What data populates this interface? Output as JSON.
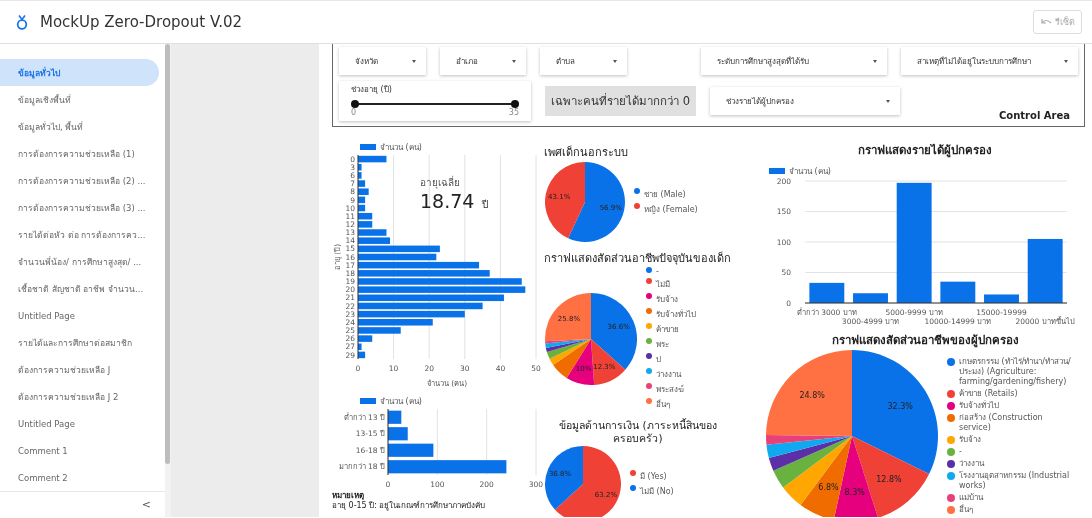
{
  "app_bar": {
    "title": "MockUp Zero-Dropout V.02",
    "reset_button": "รีเซ็ต"
  },
  "sidebar": {
    "items": [
      {
        "label": "ข้อมูลทั่วไป",
        "selected": true
      },
      {
        "label": "ข้อมูลเชิงพื้นที่",
        "selected": false
      },
      {
        "label": "ข้อมูลทั่วไป, พื้นที่",
        "selected": false
      },
      {
        "label": "การต้องการความช่วยเหลือ (1)",
        "selected": false
      },
      {
        "label": "การต้องการความช่วยเหลือ (2) ...",
        "selected": false
      },
      {
        "label": "การต้องการความช่วยเหลือ (3) ...",
        "selected": false
      },
      {
        "label": "รายได้ต่อหัว ต่อ การต้องการคว...",
        "selected": false
      },
      {
        "label": "จำนวนพี่น้อง/ การศึกษาสูงสุด/ ...",
        "selected": false
      },
      {
        "label": "เชื้อชาติ สัญชาติ อาชีพ จำนวน...",
        "selected": false
      },
      {
        "label": "Untitled Page",
        "selected": false
      },
      {
        "label": "รายได้และการศึกษาต่อสมาชิก",
        "selected": false
      },
      {
        "label": "ต้องการความช่วยเหลือ J",
        "selected": false
      },
      {
        "label": "ต้องการความช่วยเหลือ J 2",
        "selected": false
      },
      {
        "label": "Untitled Page",
        "selected": false
      },
      {
        "label": "Comment 1",
        "selected": false
      },
      {
        "label": "Comment 2",
        "selected": false
      }
    ],
    "collapse_button": "<"
  },
  "control_area": {
    "dropdowns": [
      "จังหวัด",
      "อำเภอ",
      "ตำบล",
      "ระดับการศึกษาสูงสุดที่ได้รับ",
      "สาเหตุที่ไม่ได้อยู่ในระบบการศึกษา"
    ],
    "age_slider": {
      "label": "ช่วงอายุ (ปี)",
      "min_label": "0",
      "max_label": "35",
      "level": 1
    },
    "income_filter_button": "เฉพาะคนที่รายได้มากกว่า 0",
    "income_dropdown": "ช่วงรายได้ผู้ปกครอง",
    "caption": "Control Area"
  },
  "age_chart": {
    "average_label": "อายุเฉลี่ย",
    "average_value": "18.74",
    "average_unit": "ปี",
    "chart_data": {
      "type": "bar",
      "orientation": "horizontal",
      "xlabel": "จำนวน (คน)",
      "ylabel": "อายุ (ปี)",
      "categories": [
        "0",
        "3",
        "6",
        "7",
        "8",
        "9",
        "10",
        "11",
        "12",
        "13",
        "14",
        "15",
        "16",
        "17",
        "18",
        "19",
        "20",
        "21",
        "22",
        "23",
        "24",
        "25",
        "26",
        "27",
        "29"
      ],
      "series": [
        {
          "name": "จำนวน (คน)",
          "color": "#0a72e8",
          "values": [
            8,
            1,
            1,
            2,
            3,
            2,
            2,
            4,
            4,
            8,
            9,
            23,
            22,
            34,
            37,
            46,
            47,
            41,
            35,
            30,
            21,
            12,
            4,
            1,
            2
          ]
        }
      ],
      "xlim": [
        0,
        50
      ],
      "xticks": [
        0,
        10,
        20,
        30,
        40,
        50
      ],
      "grid": true
    }
  },
  "age_group_chart": {
    "chart_data": {
      "type": "bar",
      "orientation": "horizontal",
      "categories": [
        "ต่ำกว่า 13 ปี",
        "13-15 ปี",
        "16-18 ปี",
        "มากกว่า 18 ปี"
      ],
      "series": [
        {
          "name": "จำนวน (คน)",
          "color": "#0a72e8",
          "values": [
            27,
            40,
            92,
            240
          ]
        }
      ],
      "xlim": [
        0,
        300
      ],
      "xticks": [
        0,
        100,
        200,
        300
      ],
      "grid": true
    }
  },
  "note": {
    "title": "หมายเหตุ",
    "text": "อายุ 0-15 ปี: อยู่ในเกณฑ์การศึกษาภาคบังคับ"
  },
  "gender_chart": {
    "chart_data": {
      "type": "pie",
      "title": "เพศเด็กนอกระบบ",
      "categories": [
        "ชาย (Male)",
        "หญิง (Female)"
      ],
      "values": [
        56.9,
        43.1
      ],
      "colors": [
        "#0a72e8",
        "#ef4136"
      ],
      "value_labels": [
        "56.9%",
        "43.1%"
      ]
    }
  },
  "child_job_chart": {
    "chart_data": {
      "type": "pie",
      "title": "กราฟแสดงสัดส่วนอาชีพปัจจุบันของเด็ก",
      "categories": [
        "-",
        "ไม่มี",
        "รับจ้าง",
        "รับจ้างทั่วไป",
        "ค้าขาย",
        "พระ",
        "ป",
        "ว่างงาน",
        "พระสงฆ์",
        "อื่นๆ"
      ],
      "values": [
        36.6,
        12.3,
        10,
        6.5,
        2.5,
        2.5,
        1.5,
        1.5,
        0.8,
        25.8
      ],
      "colors": [
        "#0a72e8",
        "#ef4136",
        "#e6007e",
        "#f06b00",
        "#ffa600",
        "#6ab23f",
        "#5b2fa8",
        "#0fa9f0",
        "#e8417a",
        "#ff7043"
      ],
      "value_labels": [
        "36.6%",
        "12.3%",
        "10%",
        null,
        null,
        null,
        null,
        null,
        null,
        "25.8%"
      ]
    }
  },
  "debt_chart": {
    "chart_data": {
      "type": "pie",
      "title": "ข้อมูลด้านการเงิน (ภาระหนี้สินของครอบครัว)",
      "categories": [
        "มี (Yes)",
        "ไม่มี (No)"
      ],
      "values": [
        63.2,
        36.8
      ],
      "colors": [
        "#ef4136",
        "#0a72e8"
      ],
      "value_labels": [
        "63.2%",
        "36.8%"
      ]
    }
  },
  "income_chart": {
    "chart_data": {
      "type": "bar",
      "title": "กราฟแสดงรายได้ผู้ปกครอง",
      "categories": [
        "ต่ำกว่า 3000 บาท",
        "3000-4999 บาท",
        "5000-9999 บาท",
        "10000-14999 บาท",
        "15000-19999",
        "20000 บาทขึ้นไป"
      ],
      "series": [
        {
          "name": "จำนวน (คน)",
          "color": "#0a72e8",
          "values": [
            33,
            16,
            197,
            35,
            14,
            105
          ]
        }
      ],
      "ylim": [
        0,
        200
      ],
      "yticks": [
        0,
        50,
        100,
        150,
        200
      ],
      "grid": true
    }
  },
  "parent_job_chart": {
    "chart_data": {
      "type": "pie",
      "title": "กราฟแสดงสัดส่วนอาชีพของผู้ปกครอง",
      "categories": [
        "เกษตรกรรม (ทำไร่/ทำนา/ทำสวน/ประมง) (Agriculture: farming/gardening/fishery)",
        "ค้าขาย (Retails)",
        "รับจ้างทั่วไป",
        "ก่อสร้าง (Construction service)",
        "รับจ้าง",
        "-",
        "ว่างงาน",
        "โรงงานอุตสาหกรรม (Industrial works)",
        "แม่บ้าน",
        "อื่นๆ"
      ],
      "values": [
        32.3,
        12.8,
        8.3,
        6.8,
        4.6,
        3.6,
        2.5,
        2.5,
        1.8,
        24.8
      ],
      "colors": [
        "#0a72e8",
        "#ef4136",
        "#e6007e",
        "#f06b00",
        "#ffa600",
        "#6ab23f",
        "#5b2fa8",
        "#0fa9f0",
        "#e8417a",
        "#ff7043"
      ],
      "value_labels": [
        "32.3%",
        "12.8%",
        "8.3%",
        "6.8%",
        null,
        null,
        null,
        null,
        null,
        "24.8%"
      ]
    }
  }
}
